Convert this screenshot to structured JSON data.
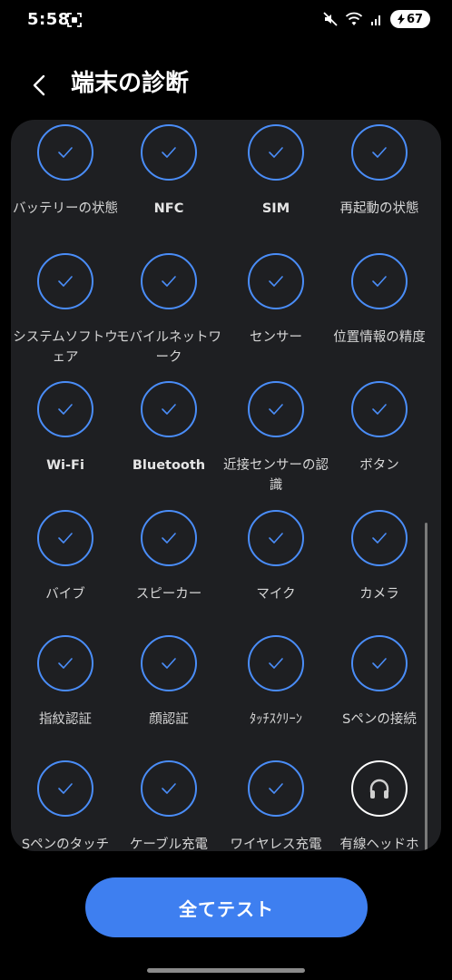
{
  "status_bar": {
    "time": "5:58",
    "battery": "67"
  },
  "header": {
    "title": "端末の診断"
  },
  "diagnostics": {
    "items": [
      {
        "label": "バッテリーの状態",
        "icon": "check-icon"
      },
      {
        "label": "NFC",
        "icon": "check-icon"
      },
      {
        "label": "SIM",
        "icon": "check-icon"
      },
      {
        "label": "再起動の状態",
        "icon": "check-icon"
      },
      {
        "label": "システムソフトウェア",
        "icon": "check-icon"
      },
      {
        "label": "モバイルネットワーク",
        "icon": "check-icon"
      },
      {
        "label": "センサー",
        "icon": "check-icon"
      },
      {
        "label": "位置情報の精度",
        "icon": "check-icon"
      },
      {
        "label": "Wi-Fi",
        "icon": "check-icon"
      },
      {
        "label": "Bluetooth",
        "icon": "check-icon"
      },
      {
        "label": "近接センサーの認識",
        "icon": "check-icon"
      },
      {
        "label": "ボタン",
        "icon": "check-icon"
      },
      {
        "label": "バイブ",
        "icon": "check-icon"
      },
      {
        "label": "スピーカー",
        "icon": "check-icon"
      },
      {
        "label": "マイク",
        "icon": "check-icon"
      },
      {
        "label": "カメラ",
        "icon": "check-icon"
      },
      {
        "label": "指紋認証",
        "icon": "check-icon"
      },
      {
        "label": "顔認証",
        "icon": "check-icon"
      },
      {
        "label": "ﾀｯﾁｽｸﾘｰﾝ",
        "icon": "check-icon"
      },
      {
        "label": "Sペンの接続",
        "icon": "check-icon"
      },
      {
        "label": "Sペンのタッチ",
        "icon": "check-icon"
      },
      {
        "label": "ケーブル充電",
        "icon": "check-icon"
      },
      {
        "label": "ワイヤレス充電",
        "icon": "check-icon"
      },
      {
        "label": "有線ヘッドホ",
        "icon": "headphones-icon"
      }
    ]
  },
  "buttons": {
    "test_all": "全てテスト"
  },
  "colors": {
    "accent": "#4a8df8",
    "button": "#3e7ff0",
    "card": "#1e1f22"
  }
}
